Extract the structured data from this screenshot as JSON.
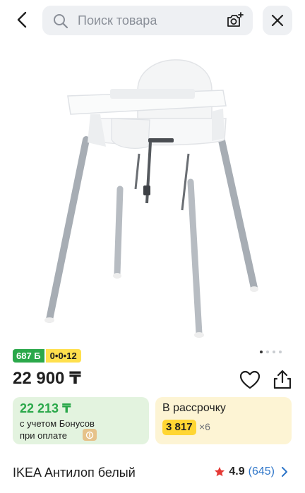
{
  "search": {
    "placeholder": "Поиск товара"
  },
  "badges": {
    "bonus": "687 Б",
    "installment": "0•0•12"
  },
  "carousel": {
    "total": 4,
    "active_index": 0
  },
  "price": {
    "main": "22 900 ₸"
  },
  "bonus_card": {
    "price": "22 213 ₸",
    "line1": "с учетом Бонусов",
    "line2": "при оплате"
  },
  "installment_card": {
    "title": "В рассрочку",
    "amount": "3 817",
    "times": "×6"
  },
  "product": {
    "title": "IKEA Антилоп белый"
  },
  "rating": {
    "score": "4.9",
    "count": "(645)"
  },
  "colors": {
    "green": "#2aa84a",
    "yellow": "#ffe04d",
    "link": "#2f76c9",
    "star": "#e53935"
  },
  "icons": [
    "back-arrow-icon",
    "search-icon",
    "camera-icon",
    "close-icon",
    "heart-icon",
    "share-icon",
    "star-icon",
    "chevron-right-icon"
  ]
}
